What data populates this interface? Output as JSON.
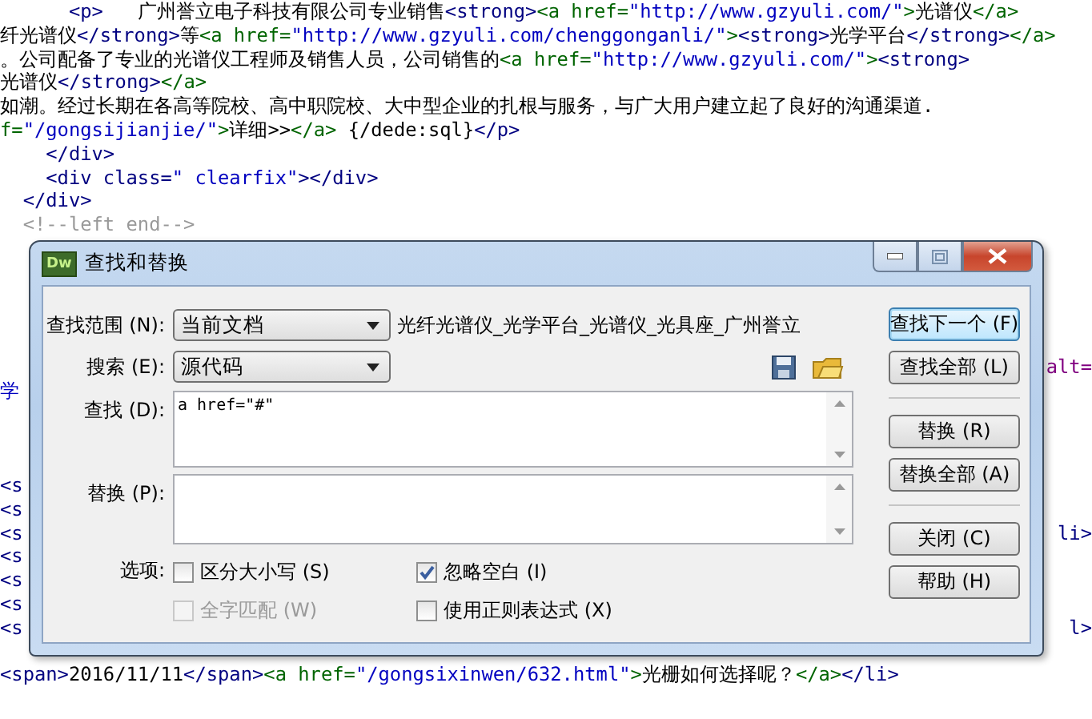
{
  "editor": {
    "lines": [
      {
        "left": [
          {
            "kind": "tag",
            "text": "      <p>"
          },
          {
            "kind": "text",
            "text": "   广州誉立电子科技有限公司专业销售"
          },
          {
            "kind": "tag",
            "text": "<strong>"
          },
          {
            "kind": "link",
            "text": "<a href="
          },
          {
            "kind": "value",
            "text": "\"http://www.gzyuli.com/\""
          },
          {
            "kind": "link",
            "text": ">"
          },
          {
            "kind": "text",
            "text": "光谱仪"
          },
          {
            "kind": "link",
            "text": "</a>"
          }
        ]
      },
      {
        "left": [
          {
            "kind": "text",
            "text": "纤光谱仪"
          },
          {
            "kind": "tag",
            "text": "</strong>"
          },
          {
            "kind": "text",
            "text": "等"
          },
          {
            "kind": "link",
            "text": "<a href="
          },
          {
            "kind": "value",
            "text": "\"http://www.gzyuli.com/chenggonganli/\""
          },
          {
            "kind": "link",
            "text": ">"
          },
          {
            "kind": "tag",
            "text": "<strong>"
          },
          {
            "kind": "text",
            "text": "光学平台"
          },
          {
            "kind": "tag",
            "text": "</strong>"
          },
          {
            "kind": "link",
            "text": "</a>"
          }
        ]
      },
      {
        "left": [
          {
            "kind": "text",
            "text": "。公司配备了专业的光谱仪工程师及销售人员，公司销售的"
          },
          {
            "kind": "link",
            "text": "<a href="
          },
          {
            "kind": "value",
            "text": "\"http://www.gzyuli.com/\""
          },
          {
            "kind": "link",
            "text": ">"
          },
          {
            "kind": "tag",
            "text": "<strong>"
          }
        ]
      },
      {
        "left": [
          {
            "kind": "text",
            "text": "光谱仪"
          },
          {
            "kind": "tag",
            "text": "</strong>"
          },
          {
            "kind": "link",
            "text": "</a>"
          }
        ]
      },
      {
        "left": [
          {
            "kind": "text",
            "text": "如潮。经过长期在各高等院校、高中职院校、大中型企业的扎根与服务，与广大用户建立起了良好的沟通渠道."
          }
        ]
      },
      {
        "left": [
          {
            "kind": "link",
            "text": "f="
          },
          {
            "kind": "value",
            "text": "\"/gongsijianjie/\""
          },
          {
            "kind": "link",
            "text": ">"
          },
          {
            "kind": "text",
            "text": "详细>>"
          },
          {
            "kind": "link",
            "text": "</a>"
          },
          {
            "kind": "text",
            "text": " {/dede:sql}"
          },
          {
            "kind": "tag",
            "text": "</p>"
          }
        ]
      },
      {
        "left": [
          {
            "kind": "tag",
            "text": "    </div>"
          }
        ]
      },
      {
        "left": [
          {
            "kind": "tag",
            "text": "    <div class="
          },
          {
            "kind": "value",
            "text": "\" clearfix\""
          },
          {
            "kind": "tag",
            "text": "></div>"
          }
        ]
      },
      {
        "left": [
          {
            "kind": "tag",
            "text": "  </div>"
          }
        ]
      },
      {
        "left": [
          {
            "kind": "comment",
            "text": "  <!--left end-->"
          }
        ]
      },
      {
        "right": [
          {
            "kind": "attr",
            "text": "alt="
          }
        ]
      },
      {
        "left": [
          {
            "kind": "value",
            "text": "学"
          }
        ]
      },
      {
        "left": [
          {
            "kind": "tag",
            "text": "<s"
          }
        ]
      },
      {
        "left": [
          {
            "kind": "tag",
            "text": "<s"
          }
        ]
      },
      {
        "left": [
          {
            "kind": "tag",
            "text": "<s"
          }
        ],
        "right": [
          {
            "kind": "tag",
            "text": "li>"
          }
        ]
      },
      {
        "left": [
          {
            "kind": "tag",
            "text": "<s"
          }
        ]
      },
      {
        "left": [
          {
            "kind": "tag",
            "text": "<s"
          }
        ]
      },
      {
        "left": [
          {
            "kind": "tag",
            "text": "<s"
          }
        ]
      },
      {
        "left": [
          {
            "kind": "tag",
            "text": "<s"
          }
        ],
        "right": [
          {
            "kind": "tag",
            "text": "l>"
          }
        ]
      },
      {
        "left": [
          {
            "kind": "tag",
            "text": "<span>"
          },
          {
            "kind": "text",
            "text": "2016/11/11"
          },
          {
            "kind": "tag",
            "text": "</span>"
          },
          {
            "kind": "link",
            "text": "<a href="
          },
          {
            "kind": "value",
            "text": "\"/gongsixinwen/632.html\""
          },
          {
            "kind": "link",
            "text": ">"
          },
          {
            "kind": "text",
            "text": "光栅如何选择呢？"
          },
          {
            "kind": "link",
            "text": "</a>"
          },
          {
            "kind": "tag",
            "text": "</li>"
          }
        ]
      }
    ]
  },
  "dialog": {
    "icon_text": "Dw",
    "title": "查找和替换",
    "scope": {
      "label": "查找范围 (N):",
      "value": "当前文档",
      "document": "光纤光谱仪_光学平台_光谱仪_光具座_广州誉立"
    },
    "search": {
      "label": "搜索 (E):",
      "value": "源代码"
    },
    "find": {
      "label": "查找 (D):",
      "value": "a href=\"#\""
    },
    "replace": {
      "label": "替换 (P):"
    },
    "options": {
      "label": "选项:",
      "checkboxes": [
        {
          "label": "区分大小写 (S)",
          "checked": false,
          "disabled": false
        },
        {
          "label": "忽略空白 (I)",
          "checked": true,
          "disabled": false
        },
        {
          "label": "全字匹配 (W)",
          "checked": false,
          "disabled": true
        },
        {
          "label": "使用正则表达式 (X)",
          "checked": false,
          "disabled": false
        }
      ]
    },
    "button_groups": [
      {
        "buttons": [
          {
            "label": "查找下一个 (F)",
            "default": true
          },
          {
            "label": "查找全部 (L)",
            "default": false
          }
        ]
      },
      {
        "buttons": [
          {
            "label": "替换 (R)",
            "default": false
          },
          {
            "label": "替换全部 (A)",
            "default": false
          }
        ]
      },
      {
        "buttons": [
          {
            "label": "关闭 (C)",
            "default": false
          },
          {
            "label": "帮助 (H)",
            "default": false
          }
        ]
      }
    ]
  }
}
